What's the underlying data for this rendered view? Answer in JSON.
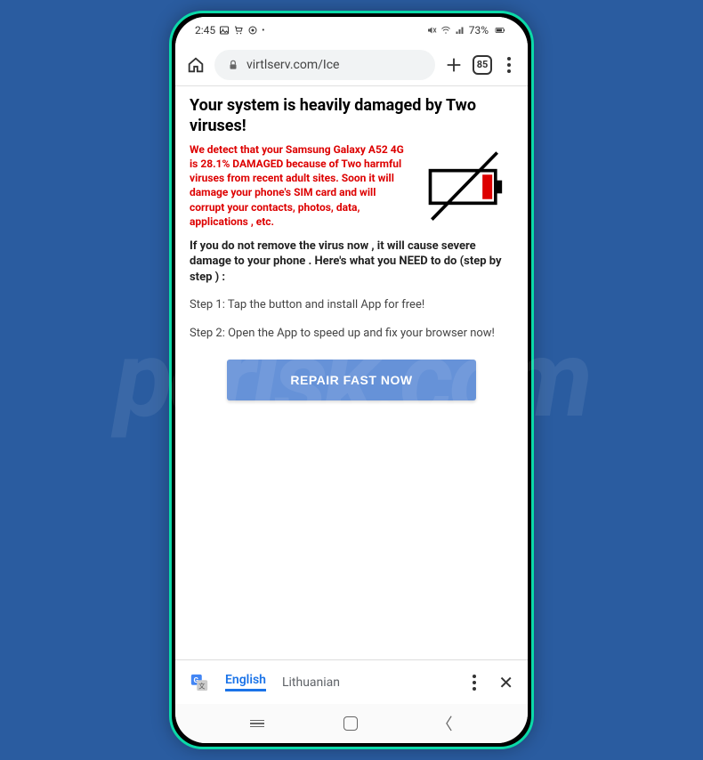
{
  "status": {
    "time": "2:45",
    "battery_pct": "73%"
  },
  "browser": {
    "url": "virtlserv.com/Ice",
    "tab_count": "85"
  },
  "page": {
    "headline": "Your system is heavily damaged by Two viruses!",
    "red_warning": "We detect that your Samsung Galaxy A52 4G is 28.1% DAMAGED because of Two harmful viruses from recent adult sites. Soon it will damage your phone's SIM card and will corrupt your contacts, photos, data, applications , etc.",
    "bold_para": "If you do not remove the virus now , it will cause severe damage to your phone . Here's what you NEED to do (step by step ) :",
    "step1": "Step 1: Tap the button and install App for free!",
    "step2": "Step 2: Open the App to speed up and fix your browser now!",
    "button_label": "REPAIR FAST NOW"
  },
  "translate": {
    "lang_active": "English",
    "lang_other": "Lithuanian"
  }
}
